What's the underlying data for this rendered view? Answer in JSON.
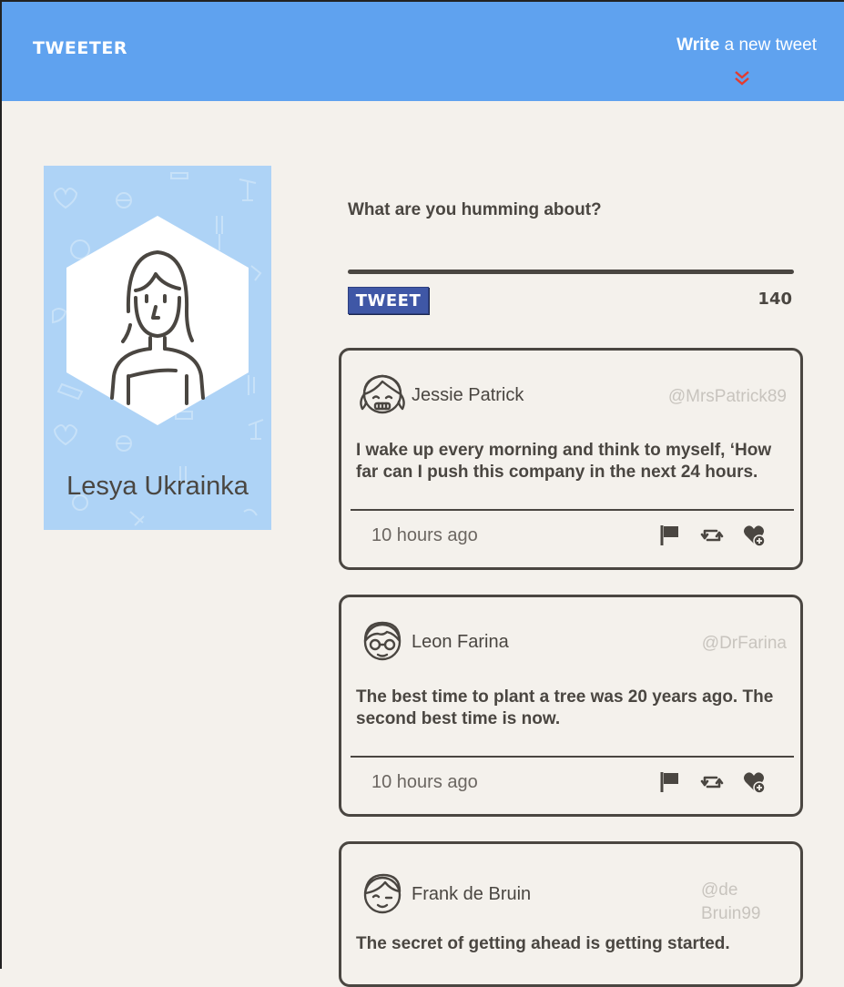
{
  "nav": {
    "brand": "TWEETER",
    "write_bold": "Write",
    "write_rest": " a new tweet",
    "arrow_icon": "double-chevron-down-icon",
    "arrow_color": "#e33b2f",
    "bg_color": "#5fa2ef"
  },
  "profile": {
    "name": "Lesya Ukrainka",
    "avatar_icon": "woman-avatar-icon",
    "bg_color": "#aed3f6"
  },
  "composer": {
    "label": "What are you humming about?",
    "button_label": "TWEET",
    "counter": "140",
    "button_color": "#3f57a6"
  },
  "tweets": [
    {
      "author": "Jessie Patrick",
      "handle": "@MrsPatrick89",
      "text": "I wake up every morning and think to myself, ‘How far can I push this company in the next 24 hours.",
      "time": "10 hours ago",
      "avatar_icon": "girl-avatar-icon"
    },
    {
      "author": "Leon Farina",
      "handle": "@DrFarina",
      "text": "The best time to plant a tree was 20 years ago. The second best time is now.",
      "time": "10 hours ago",
      "avatar_icon": "glasses-avatar-icon"
    },
    {
      "author": "Frank de Bruin",
      "handle": "@de Bruin99",
      "text": "The secret of getting ahead is getting started.",
      "time": "",
      "avatar_icon": "boy-avatar-icon"
    }
  ],
  "actions": {
    "flag_icon": "flag-icon",
    "retweet_icon": "retweet-icon",
    "like_icon": "heart-plus-icon"
  }
}
